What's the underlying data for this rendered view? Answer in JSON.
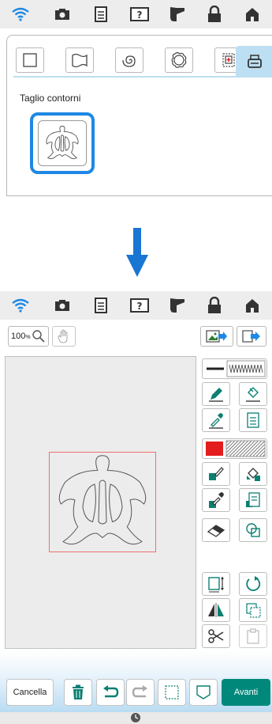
{
  "top_screen": {
    "section_label": "Taglio contorni"
  },
  "editor": {
    "zoom_value": "100",
    "zoom_unit": "%"
  },
  "bottom_bar": {
    "cancel_label": "Cancella",
    "next_label": "Avanti"
  },
  "colors": {
    "accent_blue": "#1e88e5",
    "arrow_blue": "#1976d2",
    "next_green": "#00897b",
    "icon_teal": "#0b7f72",
    "fill_red": "#e31d1d",
    "outline_red": "#f06e6e"
  }
}
